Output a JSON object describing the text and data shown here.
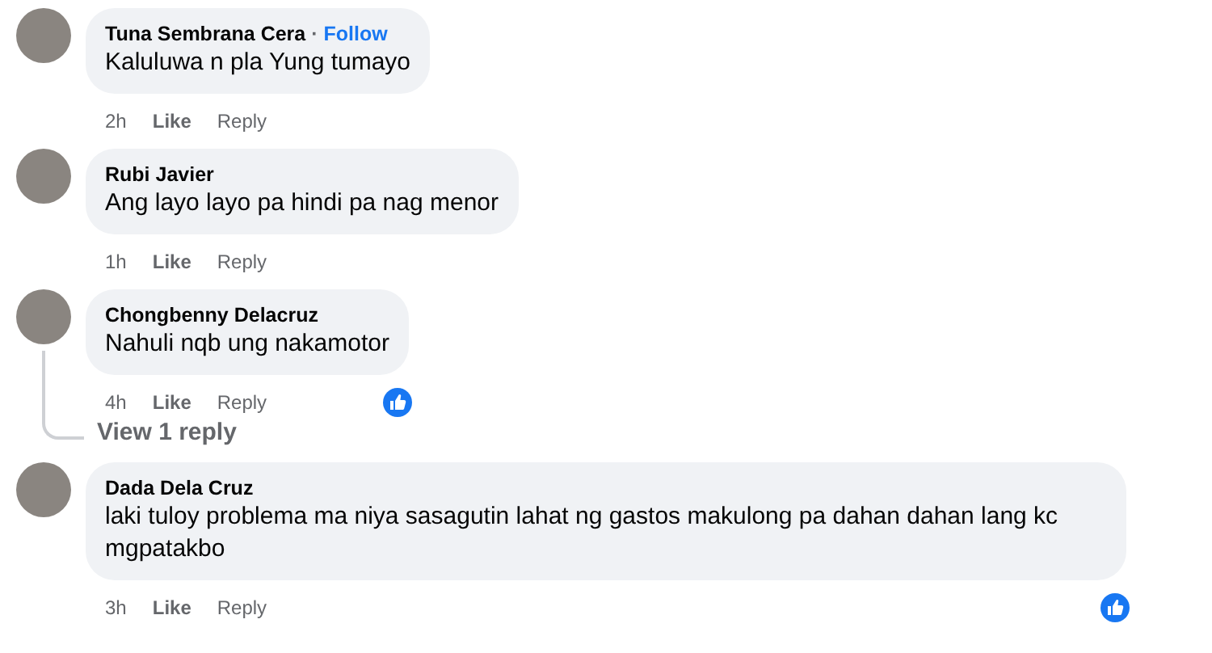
{
  "comments": [
    {
      "author": "Tuna Sembrana Cera",
      "separator": "·",
      "follow": "Follow",
      "text": "Kaluluwa n pla Yung tumayo",
      "time": "2h",
      "like": "Like",
      "reply": "Reply",
      "reacted": false
    },
    {
      "author": "Rubi Javier",
      "text": "Ang layo layo pa hindi pa nag menor",
      "time": "1h",
      "like": "Like",
      "reply": "Reply",
      "reacted": false
    },
    {
      "author": "Chongbenny Delacruz",
      "text": "Nahuli nqb ung nakamotor",
      "time": "4h",
      "like": "Like",
      "reply": "Reply",
      "reacted": true,
      "replies_label": "View 1 reply"
    },
    {
      "author": "Dada Dela Cruz",
      "text": "laki tuloy problema ma niya sasagutin lahat ng gastos makulong pa dahan dahan lang kc mgpatakbo",
      "time": "3h",
      "like": "Like",
      "reply": "Reply",
      "reacted": true
    }
  ]
}
